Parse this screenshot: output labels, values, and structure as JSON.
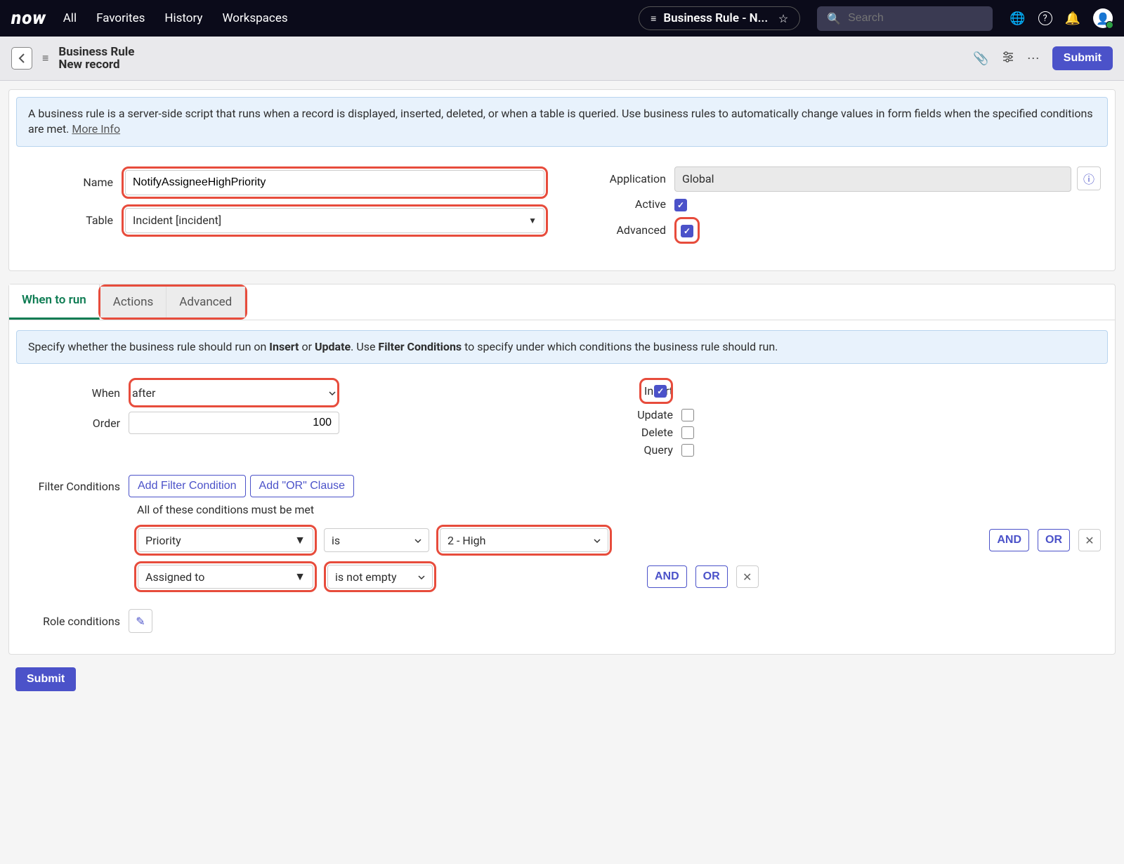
{
  "topbar": {
    "logo": "now",
    "nav": [
      "All",
      "Favorites",
      "History",
      "Workspaces"
    ],
    "pill": "Business Rule - N...",
    "search_placeholder": "Search"
  },
  "header": {
    "title": "Business Rule",
    "subtitle": "New record",
    "submit": "Submit"
  },
  "banner1": {
    "text": "A business rule is a server-side script that runs when a record is displayed, inserted, deleted, or when a table is queried. Use business rules to automatically change values in form fields when the specified conditions are met. ",
    "link": "More Info"
  },
  "form": {
    "name_label": "Name",
    "name_value": "NotifyAssigneeHighPriority",
    "table_label": "Table",
    "table_value": "Incident [incident]",
    "application_label": "Application",
    "application_value": "Global",
    "active_label": "Active",
    "advanced_label": "Advanced"
  },
  "tabs": {
    "when": "When to run",
    "actions": "Actions",
    "advanced": "Advanced"
  },
  "banner2_parts": {
    "p1": "Specify whether the business rule should run on ",
    "b1": "Insert",
    "p2": " or ",
    "b2": "Update",
    "p3": ". Use ",
    "b3": "Filter Conditions",
    "p4": " to specify under which conditions the business rule should run."
  },
  "when_form": {
    "when_label": "When",
    "when_value": "after",
    "order_label": "Order",
    "order_value": "100",
    "insert_label": "Insert",
    "update_label": "Update",
    "delete_label": "Delete",
    "query_label": "Query"
  },
  "filter": {
    "label": "Filter Conditions",
    "add_filter": "Add Filter Condition",
    "add_or": "Add \"OR\" Clause",
    "all_text": "All of these conditions must be met",
    "rows": [
      {
        "field": "Priority",
        "op": "is",
        "val": "2 - High"
      },
      {
        "field": "Assigned to",
        "op": "is not empty",
        "val": ""
      }
    ],
    "and": "AND",
    "or": "OR"
  },
  "role": {
    "label": "Role conditions"
  },
  "bottom_submit": "Submit"
}
